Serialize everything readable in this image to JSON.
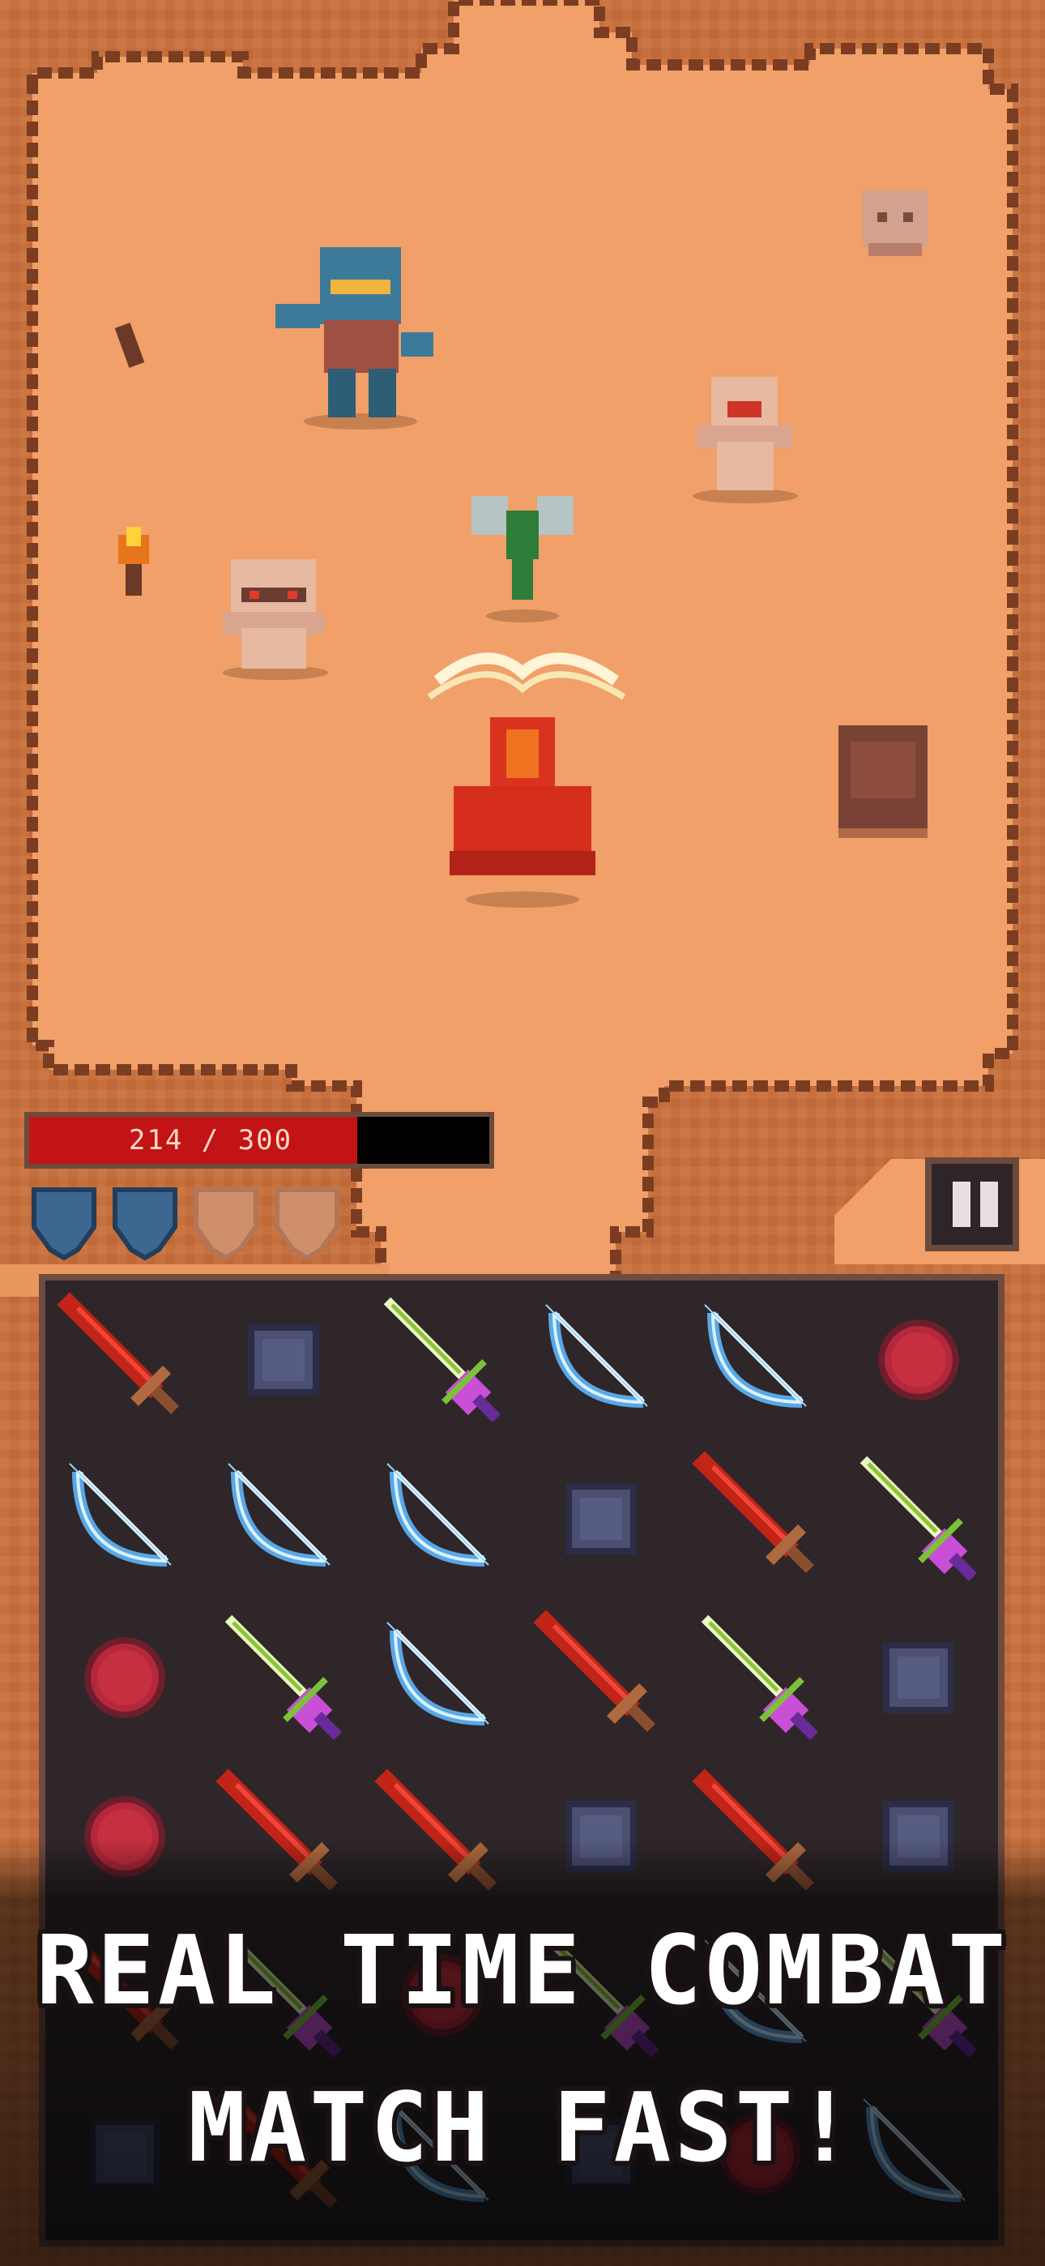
{
  "hud": {
    "hp_text": "214 / 300",
    "hp_fraction": 0.7133,
    "shields_total": 4,
    "shields_active": 2
  },
  "board": {
    "rows": [
      [
        "red-sword",
        "empty-square",
        "green-sword",
        "ice-bow",
        "ice-bow",
        "red-orb"
      ],
      [
        "ice-bow",
        "ice-bow",
        "ice-bow",
        "empty-square",
        "red-sword",
        "green-sword"
      ],
      [
        "red-orb",
        "green-sword",
        "ice-bow",
        "red-sword",
        "green-sword",
        "empty-square"
      ],
      [
        "red-orb",
        "red-sword",
        "red-sword",
        "empty-square",
        "red-sword",
        "empty-square"
      ],
      [
        "red-sword",
        "green-sword",
        "red-orb",
        "green-sword",
        "ice-bow",
        "green-sword"
      ],
      [
        "empty-square",
        "red-sword",
        "ice-bow",
        "empty-square",
        "red-orb",
        "ice-bow"
      ]
    ]
  },
  "banner": {
    "line1": "REAL TIME COMBAT",
    "line2": "MATCH FAST!"
  },
  "colors": {
    "sand": "#f0a06a",
    "rock": "#c2693a",
    "hp_fill": "#c21414",
    "board_bg": "#2f2629",
    "shield_active": "#3c6791",
    "shield_inactive": "#cf8f6b"
  },
  "icons": {
    "enemies": [
      "blue-goblin-icon",
      "mummy-icon",
      "mummy-icon",
      "green-axe-plant-icon"
    ],
    "props": [
      "skull-rock-icon",
      "torch-icon",
      "bone-icon",
      "tombstone-icon"
    ],
    "player": "red-hooded-mage-icon"
  }
}
